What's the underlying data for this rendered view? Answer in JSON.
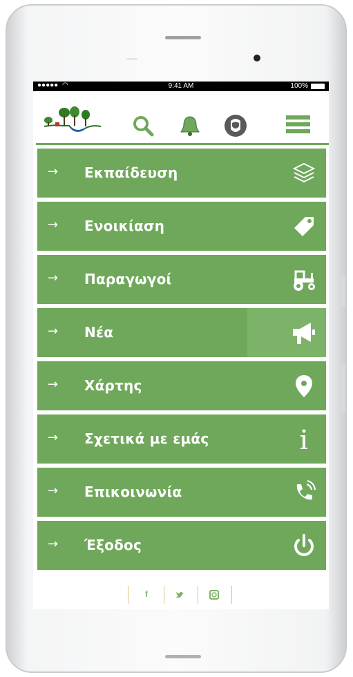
{
  "status_bar": {
    "signal": "●●●●● ",
    "time": "9:41 AM",
    "battery": "100%"
  },
  "app_bar": {
    "icons": [
      "logo-trees-icon",
      "search-icon",
      "bell-icon",
      "user-icon",
      "hamburger-menu-icon"
    ],
    "accent_color": "#6fa85a"
  },
  "menu": {
    "items": [
      {
        "label": "Εκπαίδευση",
        "icon": "layers-icon"
      },
      {
        "label": "Ενοικίαση",
        "icon": "tag-icon"
      },
      {
        "label": "Παραγωγοί",
        "icon": "tractor-icon"
      },
      {
        "label": "Νέα",
        "icon": "megaphone-icon"
      },
      {
        "label": "Χάρτης",
        "icon": "map-marker-icon"
      },
      {
        "label": "Σχετικά με εμάς",
        "icon": "info-icon"
      },
      {
        "label": "Επικοινωνία",
        "icon": "phone-icon"
      },
      {
        "label": "Έξοδος",
        "icon": "power-icon"
      }
    ],
    "arrow": "→",
    "item_color": "#6fa85a"
  },
  "social": {
    "facebook": "f",
    "twitter": "twitter-icon",
    "instagram": "instagram-icon"
  }
}
